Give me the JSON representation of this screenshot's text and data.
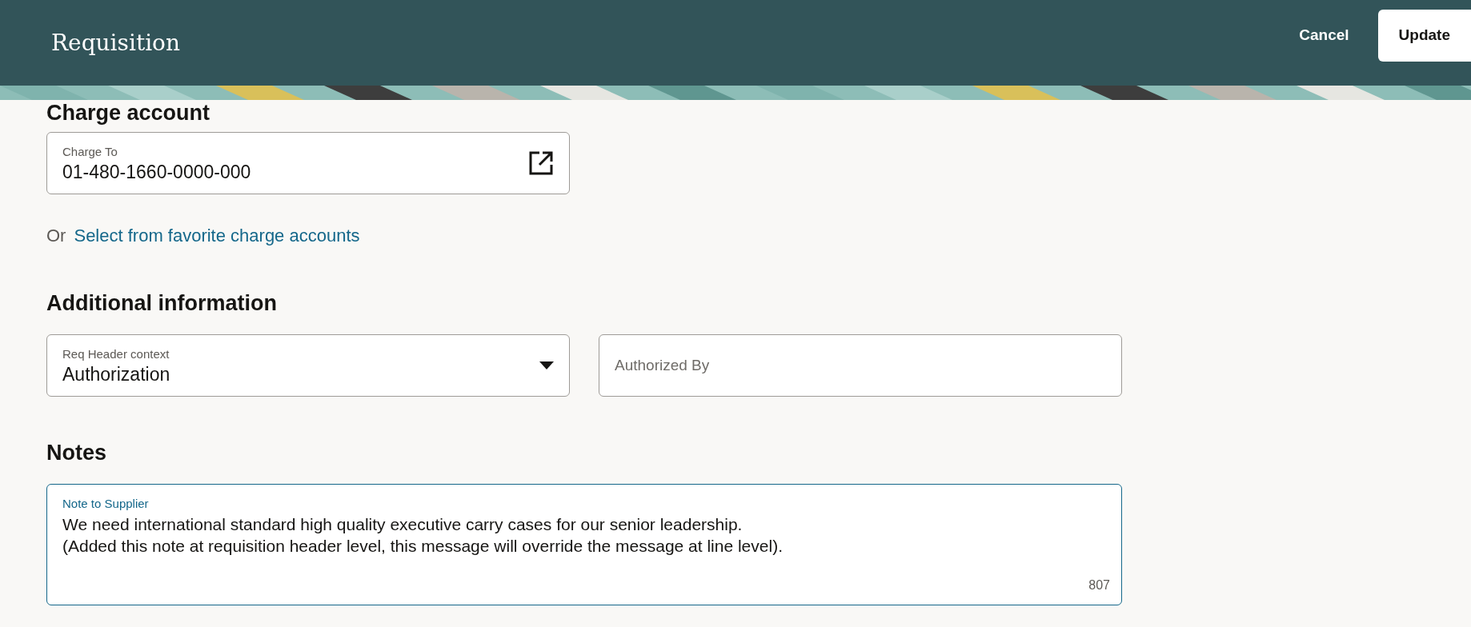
{
  "header": {
    "title": "Requisition",
    "buttons": [
      {
        "label": "Cancel",
        "kind": "text"
      },
      {
        "label": "Update",
        "kind": "solid"
      }
    ]
  },
  "charge_account": {
    "heading": "Charge account",
    "field": {
      "label": "Charge To",
      "value": "01-480-1660-0000-000"
    },
    "or_text": "Or",
    "link": "Select from favorite charge accounts"
  },
  "additional_information": {
    "heading": "Additional information",
    "fields": [
      {
        "kind": "select",
        "label": "Req Header context",
        "value": "Authorization"
      },
      {
        "kind": "text",
        "placeholder": "Authorized By"
      }
    ]
  },
  "notes": {
    "heading": "Notes",
    "field": {
      "label": "Note to Supplier",
      "focused": true,
      "lines": [
        "We need international standard high quality executive carry cases for our senior leadership.",
        "(Added this note at requisition header level, this message will override the message at line level)."
      ],
      "counter": "807"
    }
  }
}
